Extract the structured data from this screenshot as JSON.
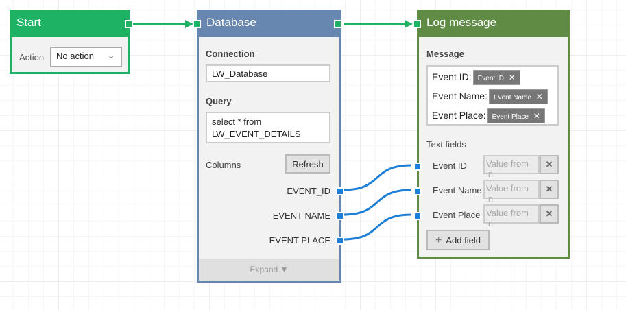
{
  "start": {
    "title": "Start",
    "action_label": "Action",
    "action_value": "No action"
  },
  "database": {
    "title": "Database",
    "connection_label": "Connection",
    "connection_value": "LW_Database",
    "query_label": "Query",
    "query_line1": "select * from",
    "query_line2": "LW_EVENT_DETAILS",
    "columns_label": "Columns",
    "refresh_label": "Refresh",
    "columns": [
      "EVENT_ID",
      "EVENT NAME",
      "EVENT PLACE"
    ],
    "expand_label": "Expand ▼"
  },
  "log": {
    "title": "Log message",
    "message_label": "Message",
    "message_rows": [
      {
        "text": "Event ID:",
        "tag": "Event ID"
      },
      {
        "text": "Event Name:",
        "tag": "Event Name"
      },
      {
        "text": "Event Place:",
        "tag": "Event Place"
      }
    ],
    "text_fields_label": "Text fields",
    "fields": [
      {
        "name": "Event ID",
        "placeholder": "Value from in"
      },
      {
        "name": "Event Name",
        "placeholder": "Value from in"
      },
      {
        "name": "Event Place",
        "placeholder": "Value from in"
      }
    ],
    "add_field_label": "Add field"
  },
  "colors": {
    "start": "#1db264",
    "database": "#6787b0",
    "log": "#5f8b45",
    "data_link": "#1e7fd6"
  }
}
